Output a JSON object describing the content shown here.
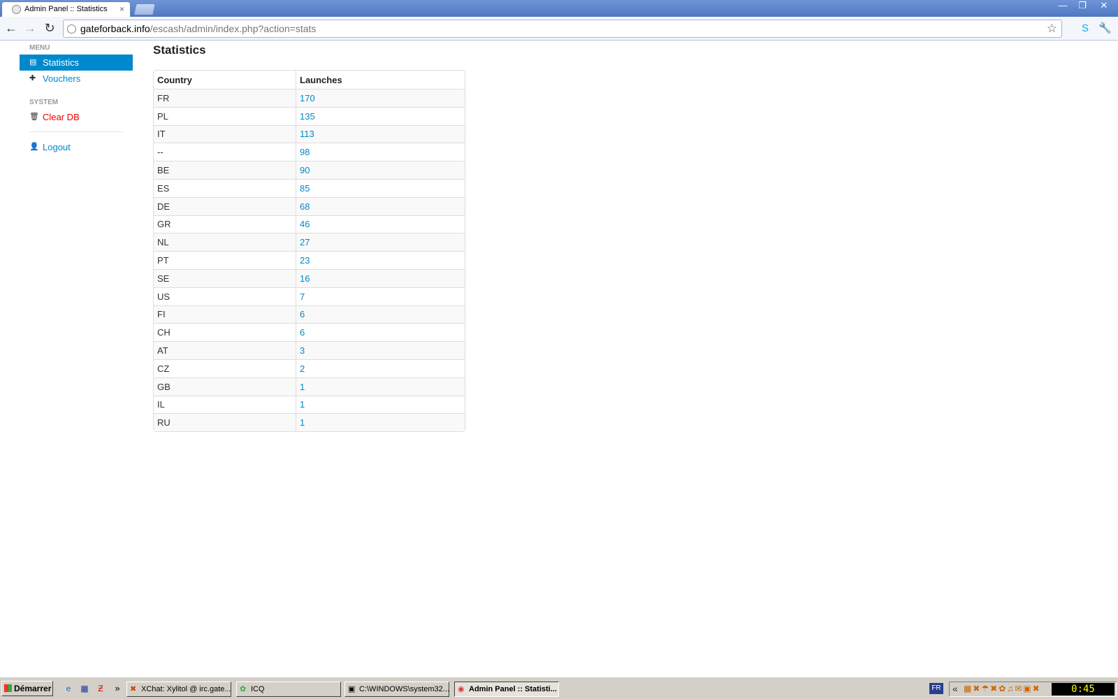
{
  "browser": {
    "tab_title": "Admin Panel :: Statistics",
    "tab_close": "×",
    "url_host": "gateforback.info",
    "url_path": "/escash/admin/index.php?action=stats",
    "icons": {
      "back": "←",
      "forward": "→",
      "reload": "↻",
      "star": "☆",
      "skype": "S",
      "wrench": "🔧"
    },
    "window_buttons": {
      "minimize": "—",
      "maximize": "❐",
      "close": "✕"
    }
  },
  "sidebar": {
    "menu_header": "MENU",
    "system_header": "SYSTEM",
    "items": [
      {
        "label": "Statistics",
        "icon": "▤"
      },
      {
        "label": "Vouchers",
        "icon": "✚"
      },
      {
        "label": "Clear DB",
        "icon": "🗑"
      },
      {
        "label": "Logout",
        "icon": "👤"
      }
    ]
  },
  "main": {
    "title": "Statistics",
    "table": {
      "headers": [
        "Country",
        "Launches"
      ],
      "rows": [
        [
          "FR",
          "170"
        ],
        [
          "PL",
          "135"
        ],
        [
          "IT",
          "113"
        ],
        [
          "--",
          "98"
        ],
        [
          "BE",
          "90"
        ],
        [
          "ES",
          "85"
        ],
        [
          "DE",
          "68"
        ],
        [
          "GR",
          "46"
        ],
        [
          "NL",
          "27"
        ],
        [
          "PT",
          "23"
        ],
        [
          "SE",
          "16"
        ],
        [
          "US",
          "7"
        ],
        [
          "FI",
          "6"
        ],
        [
          "CH",
          "6"
        ],
        [
          "AT",
          "3"
        ],
        [
          "CZ",
          "2"
        ],
        [
          "GB",
          "1"
        ],
        [
          "IL",
          "1"
        ],
        [
          "RU",
          "1"
        ]
      ]
    }
  },
  "taskbar": {
    "start_label": "Démarrer",
    "quick_more": "»",
    "tasks": [
      {
        "label": "XChat: Xylitol @ irc.gate...",
        "icon": "✖"
      },
      {
        "label": "ICQ",
        "icon": "✿"
      },
      {
        "label": "C:\\WINDOWS\\system32...",
        "icon": "▣"
      },
      {
        "label": "Admin Panel :: Statisti...",
        "icon": "◉"
      }
    ],
    "language": "FR",
    "tray_chevron": "«",
    "tray_icons": "▦✖☂✖✿♫✉▣✖",
    "clock": "0:45"
  }
}
